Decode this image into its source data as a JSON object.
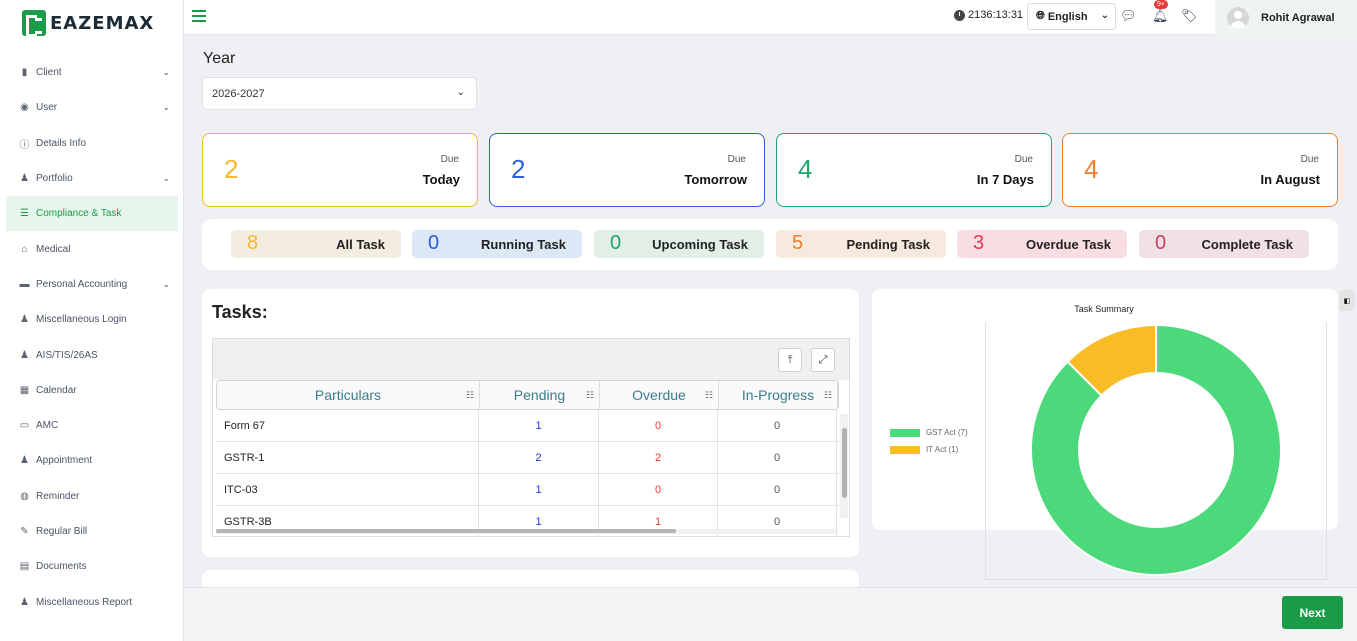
{
  "brand": {
    "name": "EAZEMAX"
  },
  "sidebar": {
    "items": [
      {
        "label": "Client",
        "icon": "building-icon",
        "chevron": true
      },
      {
        "label": "User",
        "icon": "user-circle-icon",
        "chevron": true
      },
      {
        "label": "Details Info",
        "icon": "info-icon",
        "chevron": false
      },
      {
        "label": "Portfolio",
        "icon": "person-icon",
        "chevron": true
      },
      {
        "label": "Compliance & Task",
        "icon": "list-check-icon",
        "chevron": false,
        "active": true
      },
      {
        "label": "Medical",
        "icon": "hospital-icon",
        "chevron": false
      },
      {
        "label": "Personal Accounting",
        "icon": "wallet-icon",
        "chevron": true
      },
      {
        "label": "Miscellaneous Login",
        "icon": "person-icon",
        "chevron": false
      },
      {
        "label": "AIS/TIS/26AS",
        "icon": "person-icon",
        "chevron": false
      },
      {
        "label": "Calendar",
        "icon": "calendar-icon",
        "chevron": false
      },
      {
        "label": "AMC",
        "icon": "card-icon",
        "chevron": false
      },
      {
        "label": "Appointment",
        "icon": "person-icon",
        "chevron": false
      },
      {
        "label": "Reminder",
        "icon": "bell-icon",
        "chevron": false
      },
      {
        "label": "Regular Bill",
        "icon": "pen-icon",
        "chevron": false
      },
      {
        "label": "Documents",
        "icon": "document-icon",
        "chevron": false
      },
      {
        "label": "Miscellaneous Report",
        "icon": "person-icon",
        "chevron": false
      }
    ]
  },
  "topbar": {
    "time": "2136:13:31",
    "language": "English",
    "notification_badge": "9+",
    "user_name": "Rohit Agrawal"
  },
  "year": {
    "label": "Year",
    "selected": "2026-2027"
  },
  "due_cards": [
    {
      "count": "2",
      "due": "Due",
      "when": "Today",
      "color": "#f5b92c"
    },
    {
      "count": "2",
      "due": "Due",
      "when": "Tomorrow",
      "color": "#2d5fdc"
    },
    {
      "count": "4",
      "due": "Due",
      "when": "In 7 Days",
      "color": "#1fa66b"
    },
    {
      "count": "4",
      "due": "Due",
      "when": "In August",
      "color": "#f47e2b"
    }
  ],
  "task_chips": [
    {
      "count": "8",
      "label": "All Task",
      "bg": "#f3ede1",
      "color": "#f5b92c"
    },
    {
      "count": "0",
      "label": "Running Task",
      "bg": "#dde8f6",
      "color": "#2d5fdc"
    },
    {
      "count": "0",
      "label": "Upcoming Task",
      "bg": "#e1efe7",
      "color": "#1fa66b"
    },
    {
      "count": "5",
      "label": "Pending Task",
      "bg": "#f6e9dd",
      "color": "#f47e2b"
    },
    {
      "count": "3",
      "label": "Overdue Task",
      "bg": "#f8dde2",
      "color": "#e5384f"
    },
    {
      "count": "0",
      "label": "Complete Task",
      "bg": "#f1e1e6",
      "color": "#c4455e"
    }
  ],
  "tasks": {
    "title": "Tasks:",
    "columns": [
      "Particulars",
      "Pending",
      "Overdue",
      "In-Progress"
    ],
    "rows": [
      [
        "Form 67",
        "1",
        "0",
        "0"
      ],
      [
        "GSTR-1",
        "2",
        "2",
        "0"
      ],
      [
        "ITC-03",
        "1",
        "0",
        "0"
      ],
      [
        "GSTR-3B",
        "1",
        "1",
        "0"
      ]
    ]
  },
  "chart": {
    "title": "Task Summary",
    "legend": [
      "GST Act (7)",
      "IT Act (1)"
    ]
  },
  "chart_data": {
    "type": "pie",
    "title": "Task Summary",
    "categories": [
      "GST Act",
      "IT Act"
    ],
    "values": [
      7,
      1
    ],
    "colors": [
      "#4cd97b",
      "#f8bd26"
    ],
    "donut": true,
    "legend_position": "left"
  },
  "footer": {
    "next_label": "Next"
  }
}
